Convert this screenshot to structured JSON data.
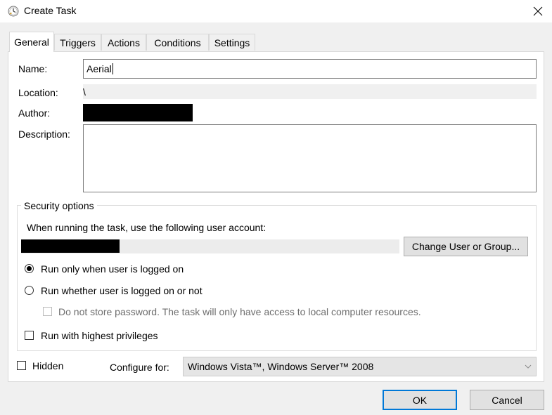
{
  "window": {
    "title": "Create Task",
    "icon": "task-scheduler-clock-icon"
  },
  "tabs": [
    {
      "label": "General",
      "active": true
    },
    {
      "label": "Triggers",
      "active": false
    },
    {
      "label": "Actions",
      "active": false
    },
    {
      "label": "Conditions",
      "active": false
    },
    {
      "label": "Settings",
      "active": false
    }
  ],
  "general": {
    "name_label": "Name:",
    "name_value": "Aerial",
    "location_label": "Location:",
    "location_value": "\\",
    "author_label": "Author:",
    "author_value": "",
    "description_label": "Description:",
    "description_value": ""
  },
  "security": {
    "group_title": "Security options",
    "account_prompt": "When running the task, use the following user account:",
    "account_value": "",
    "change_button": "Change User or Group...",
    "radio_logged_on": {
      "label": "Run only when user is logged on",
      "selected": true
    },
    "radio_whether": {
      "label": "Run whether user is logged on or not",
      "selected": false
    },
    "do_not_store": {
      "label": "Do not store password.  The task will only have access to local computer resources.",
      "checked": false,
      "enabled": false
    },
    "highest_privileges": {
      "label": "Run with highest privileges",
      "checked": false
    }
  },
  "footer": {
    "hidden": {
      "label": "Hidden",
      "checked": false
    },
    "configure_label": "Configure for:",
    "configure_value": "Windows Vista™, Windows Server™ 2008",
    "ok_button": "OK",
    "cancel_button": "Cancel"
  },
  "colors": {
    "accent": "#0078d7",
    "window_bg": "#f0f0f0",
    "panel_bg": "#ffffff"
  }
}
